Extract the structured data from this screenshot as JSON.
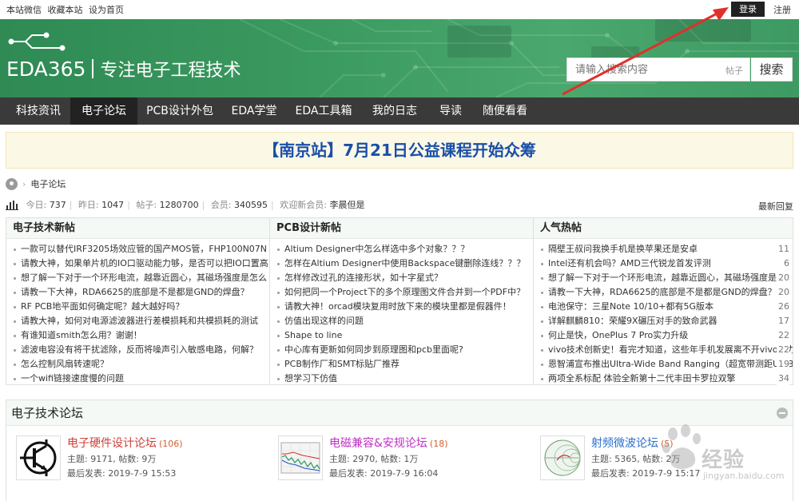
{
  "topbar": {
    "links": [
      "本站微信",
      "收藏本站",
      "设为首页"
    ],
    "login_label": "登录",
    "register_label": "注册"
  },
  "header": {
    "logo_text": "EDA365",
    "slogan": "专注电子工程技术",
    "search_placeholder": "请输入搜索内容",
    "search_scope": "帖子",
    "search_button": "搜索"
  },
  "nav": {
    "items": [
      "科技资讯",
      "电子论坛",
      "PCB设计外包",
      "EDA学堂",
      "EDA工具箱",
      "我的日志",
      "导读",
      "随便看看"
    ],
    "active_index": 1
  },
  "announcement": "【南京站】7月21日公益课程开始众筹",
  "breadcrumb": {
    "current": "电子论坛"
  },
  "stats": {
    "today_label": "今日:",
    "today": "737",
    "yesterday_label": "昨日:",
    "yesterday": "1047",
    "posts_label": "帖子:",
    "posts": "1280700",
    "members_label": "会员:",
    "members": "340595",
    "welcome_label": "欢迎新会员:",
    "new_member": "李晨但是",
    "latest_reply": "最新回复"
  },
  "columns": [
    {
      "title": "电子技术新帖",
      "items": [
        "一款可以替代IRF3205场效应管的国产MOS管，FHP100N07N",
        "请教大神，如果单片机的IO口驱动能力够，是否可以把IO口置高",
        "想了解一下对于一个环形电流，越靠近圆心，其磁场强度是怎么",
        "请教一下大神，RDA6625的底部是不是都是GND的焊盘？",
        "RF PCB地平面如何确定呢？越大越好吗？",
        "请教大神，如何对电源滤波器进行差模损耗和共模损耗的测试",
        "有谁知道smith怎么用？谢谢！",
        "滤波电容没有将干扰滤除，反而将噪声引入敏感电路，何解？",
        "怎么控制风扇转速呢？",
        "一个wifi链接速度慢的问题"
      ]
    },
    {
      "title": "PCB设计新帖",
      "items": [
        "Altium Designer中怎么样选中多个对象？？？",
        "怎样在Altium Designer中使用Backspace键删除连线？？？",
        "怎样修改过孔的连接形状，如十字星式？",
        "如何把同一个Project下的多个原理图文件合并到一个PDF中？",
        "请教大神！orcad模块复用时放下来的模块里都是假器件！",
        "仿值出现这样的问题",
        "Shape to line",
        "中心库有更新如何同步到原理图和pcb里面呢?",
        "PCB制作厂和SMT标贴厂推荐",
        "想学习下仿值"
      ]
    },
    {
      "title": "人气热帖",
      "items": [
        {
          "text": "隔壁王叔问我换手机是换苹果还是安卓",
          "num": "11"
        },
        {
          "text": "Intel还有机会吗？AMD三代锐龙首发评测",
          "num": "6"
        },
        {
          "text": "想了解一下对于一个环形电流，越靠近圆心，其磁场强度是怎",
          "num": "20"
        },
        {
          "text": "请教一下大神，RDA6625的底部是不是都是GND的焊盘？",
          "num": "20"
        },
        {
          "text": "电池保守：三星Note 10/10+都有5G版本",
          "num": "26"
        },
        {
          "text": "详解麒麟810：荣耀9X碾压对手的致命武器",
          "num": "17"
        },
        {
          "text": "何止是快，OnePlus 7 Pro实力升级",
          "num": "22"
        },
        {
          "text": "vivo技术创新史！看完才知道，这些年手机发展离不开vivo助力",
          "num": "22"
        },
        {
          "text": "恩智浦宣布推出Ultra-Wide Band Ranging（超宽带测距UWB）",
          "num": "19"
        },
        {
          "text": "两项全系标配 体验全新第十二代丰田卡罗拉双擎",
          "num": "34"
        }
      ]
    }
  ],
  "forum": {
    "title": "电子技术论坛",
    "boards": [
      {
        "name": "电子硬件设计论坛",
        "count": "(106)",
        "stats": "主题: 9171, 帖数: 9万",
        "last": "最后发表: 2019-7-9 15:53",
        "icon": "transistor-icon",
        "color": "#d0403a"
      },
      {
        "name": "电磁兼容&安规论坛",
        "count": "(18)",
        "stats": "主题: 2970, 帖数: 1万",
        "last": "最后发表: 2019-7-9 16:04",
        "icon": "emc-chart-icon",
        "color": "#c030c8"
      },
      {
        "name": "射频微波论坛",
        "count": "(5)",
        "stats": "主题: 5365, 帖数: 2万",
        "last": "最后发表: 2019-7-9 15:17",
        "icon": "smith-chart-icon",
        "color": "#2a6fd0"
      }
    ]
  },
  "watermark": {
    "text": "经验",
    "sub": "jingyan.baidu.com"
  },
  "colors": {
    "banner": "#3b9a60",
    "nav": "#3a3a3a",
    "announce_text": "#1a4fa8",
    "arrow": "#e0302a"
  }
}
